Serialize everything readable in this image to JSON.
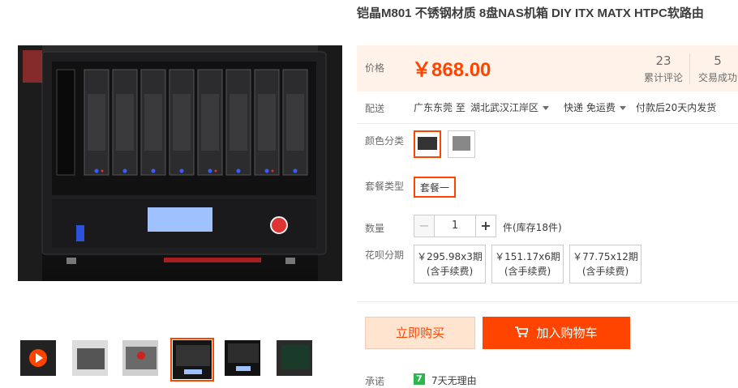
{
  "product": {
    "title": "铠晶M801 不锈钢材质 8盘NAS机箱 DIY ITX MATX HTPC软路由"
  },
  "price": {
    "label": "价格",
    "value": "￥868.00"
  },
  "stats": {
    "reviews_count": "23",
    "reviews_label": "累计评论",
    "sales_count": "5",
    "sales_label": "交易成功"
  },
  "shipping": {
    "label": "配送",
    "from": "广东东莞 至",
    "to": "湖北武汉江岸区",
    "courier": "快递 免运费",
    "note": "付款后20天内发货"
  },
  "color": {
    "label": "颜色分类"
  },
  "package": {
    "label": "套餐类型",
    "selected": "套餐一"
  },
  "quantity": {
    "label": "数量",
    "minus": "−",
    "value": "1",
    "plus": "+",
    "stock": "件(库存18件)"
  },
  "installment": {
    "label": "花呗分期",
    "options": [
      {
        "amount": "￥295.98x3期",
        "fee": "(含手续费)"
      },
      {
        "amount": "￥151.17x6期",
        "fee": "(含手续费)"
      },
      {
        "amount": "￥77.75x12期",
        "fee": "(含手续费)"
      }
    ]
  },
  "actions": {
    "buy_now": "立即购买",
    "add_to_cart": "加入购物车"
  },
  "promise": {
    "label": "承诺",
    "badge": "7",
    "text": "7天无理由"
  },
  "colors": {
    "accent": "#ff4400",
    "price_bg": "#fff2e8",
    "buy_bg": "#ffe4d0"
  }
}
